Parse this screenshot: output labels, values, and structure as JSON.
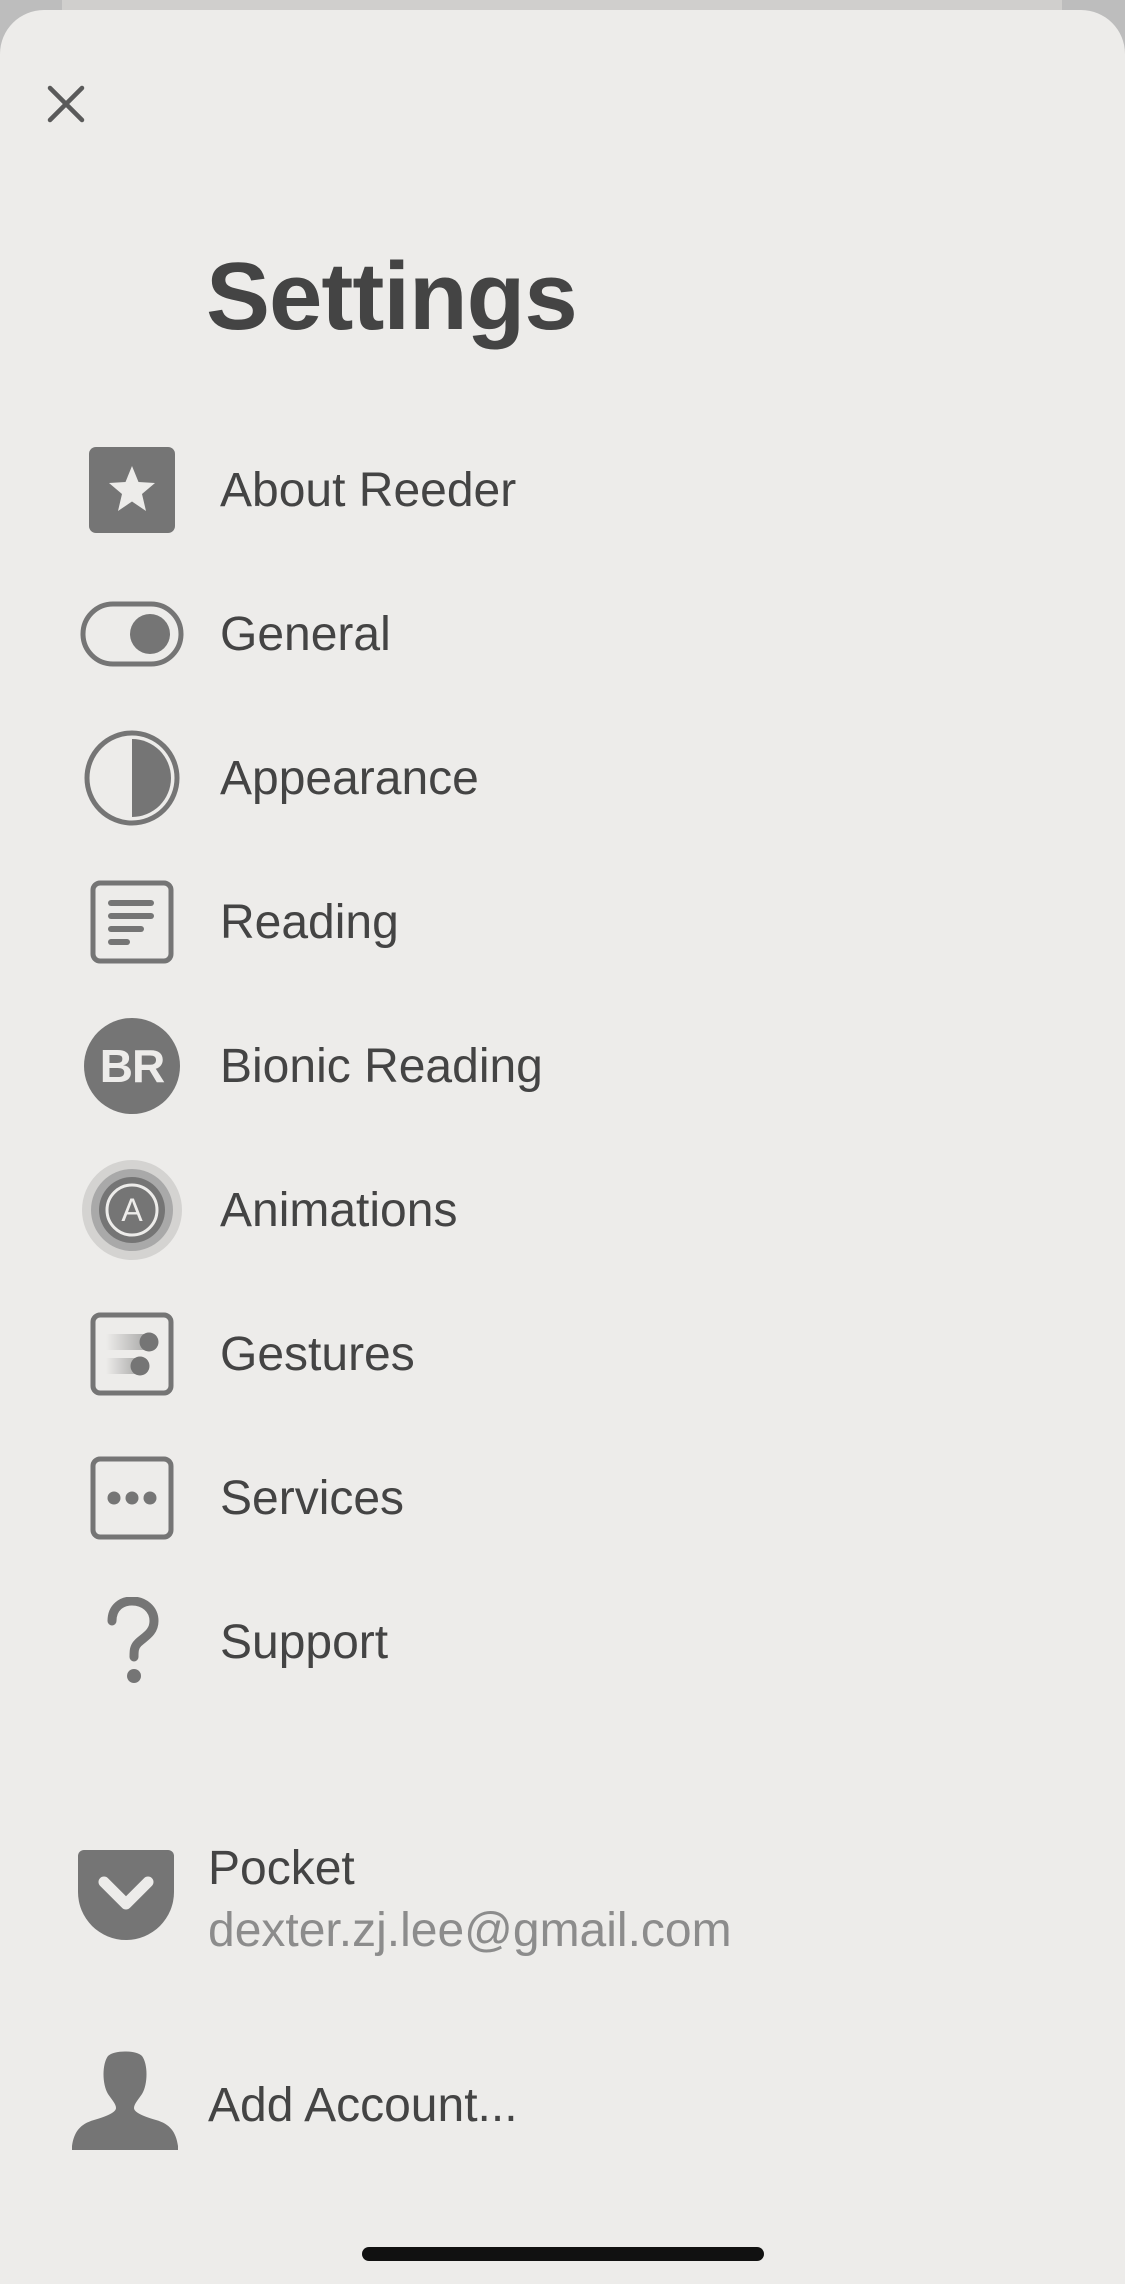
{
  "header": {
    "title": "Settings",
    "close_icon": "close-icon"
  },
  "menu": {
    "items": [
      {
        "label": "About Reeder",
        "icon": "star-icon"
      },
      {
        "label": "General",
        "icon": "toggle-icon"
      },
      {
        "label": "Appearance",
        "icon": "half-circle-icon"
      },
      {
        "label": "Reading",
        "icon": "text-lines-icon"
      },
      {
        "label": "Bionic Reading",
        "icon": "bionic-reading-icon",
        "icon_text": "BR"
      },
      {
        "label": "Animations",
        "icon": "animations-icon",
        "icon_text": "A"
      },
      {
        "label": "Gestures",
        "icon": "gestures-icon"
      },
      {
        "label": "Services",
        "icon": "ellipsis-box-icon"
      },
      {
        "label": "Support",
        "icon": "question-mark-icon"
      }
    ]
  },
  "accounts": {
    "pocket": {
      "name": "Pocket",
      "email": "dexter.zj.lee@gmail.com",
      "icon": "pocket-icon"
    },
    "add": {
      "label": "Add Account...",
      "icon": "person-icon"
    }
  },
  "colors": {
    "background": "#edecea",
    "text": "#444444",
    "icon": "#757575",
    "secondary_text": "#8c8c8c"
  }
}
